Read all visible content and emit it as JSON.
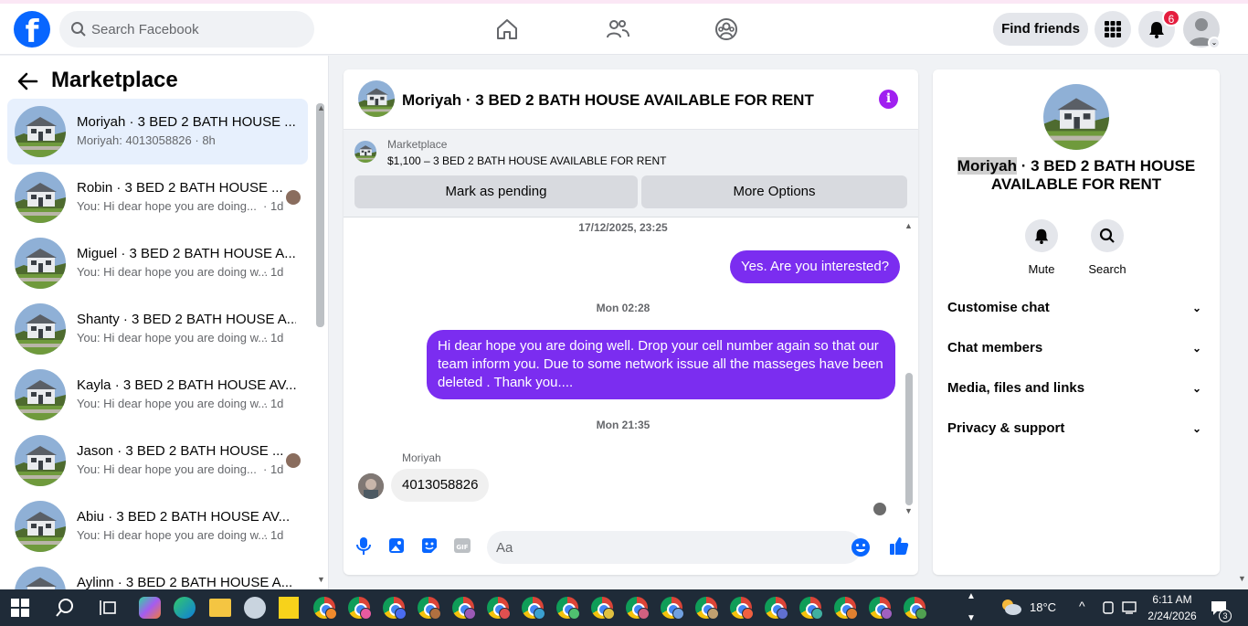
{
  "colors": {
    "brand": "#0866ff",
    "accent": "#7b2df0",
    "badge": "#e41e3f"
  },
  "topbar": {
    "search_placeholder": "Search Facebook",
    "find_friends": "Find friends",
    "notification_count": "6",
    "icons": [
      "facebook-logo",
      "search-icon",
      "home-icon",
      "friends-icon",
      "groups-icon",
      "menu-grid-icon",
      "bell-icon",
      "profile-avatar"
    ]
  },
  "left": {
    "title": "Marketplace",
    "conversations": [
      {
        "name": "Moriyah · 3 BED 2 BATH HOUSE ...",
        "preview": "Moriyah: 4013058826 · 8h",
        "time": "",
        "active": true
      },
      {
        "name": "Robin · 3 BED 2 BATH HOUSE ...",
        "preview": "You: Hi dear hope you are doing...",
        "time": "· 1d"
      },
      {
        "name": "Miguel · 3 BED 2 BATH HOUSE A...",
        "preview": "You: Hi dear hope you are doing w...",
        "time": "· 1d"
      },
      {
        "name": "Shanty · 3 BED 2 BATH HOUSE A...",
        "preview": "You: Hi dear hope you are doing w...",
        "time": "· 1d"
      },
      {
        "name": "Kayla · 3 BED 2 BATH HOUSE AV...",
        "preview": "You: Hi dear hope you are doing w...",
        "time": "· 1d"
      },
      {
        "name": "Jason · 3 BED 2 BATH HOUSE ...",
        "preview": "You: Hi dear hope you are doing...",
        "time": "· 1d"
      },
      {
        "name": "Abiu · 3 BED 2 BATH HOUSE AV...",
        "preview": "You: Hi dear hope you are doing w...",
        "time": "· 1d"
      },
      {
        "name": "Aylinn · 3 BED 2 BATH HOUSE A...",
        "preview": "",
        "time": ""
      }
    ]
  },
  "chat": {
    "title": "Moriyah · 3 BED 2 BATH HOUSE AVAILABLE FOR RENT",
    "marketplace_label": "Marketplace",
    "listing": "$1,100 – 3 BED 2 BATH HOUSE AVAILABLE FOR RENT",
    "mark_pending": "Mark as pending",
    "more_options": "More Options",
    "timestamps": [
      "17/12/2025, 23:25",
      "Mon 02:28",
      "Mon 21:35"
    ],
    "messages": [
      {
        "from": "me",
        "text": "Yes. Are you interested?"
      },
      {
        "from": "me",
        "text": "Hi dear hope you are doing well.  Drop your cell number again so that our team  inform you.  Due to some network issue all the masseges have been deleted . Thank you...."
      },
      {
        "from": "Moriyah",
        "text": "4013058826"
      }
    ],
    "sender_name": "Moriyah",
    "composer_placeholder": "Aa"
  },
  "right": {
    "title_name": "Moriyah",
    "title_rest": " · 3 BED 2 BATH HOUSE AVAILABLE FOR RENT",
    "mute": "Mute",
    "search": "Search",
    "menu": [
      "Customise chat",
      "Chat members",
      "Media, files and links",
      "Privacy & support"
    ]
  },
  "taskbar": {
    "temperature": "18°C",
    "time": "6:11 AM",
    "date": "2/24/2026",
    "notification_count": "3"
  }
}
